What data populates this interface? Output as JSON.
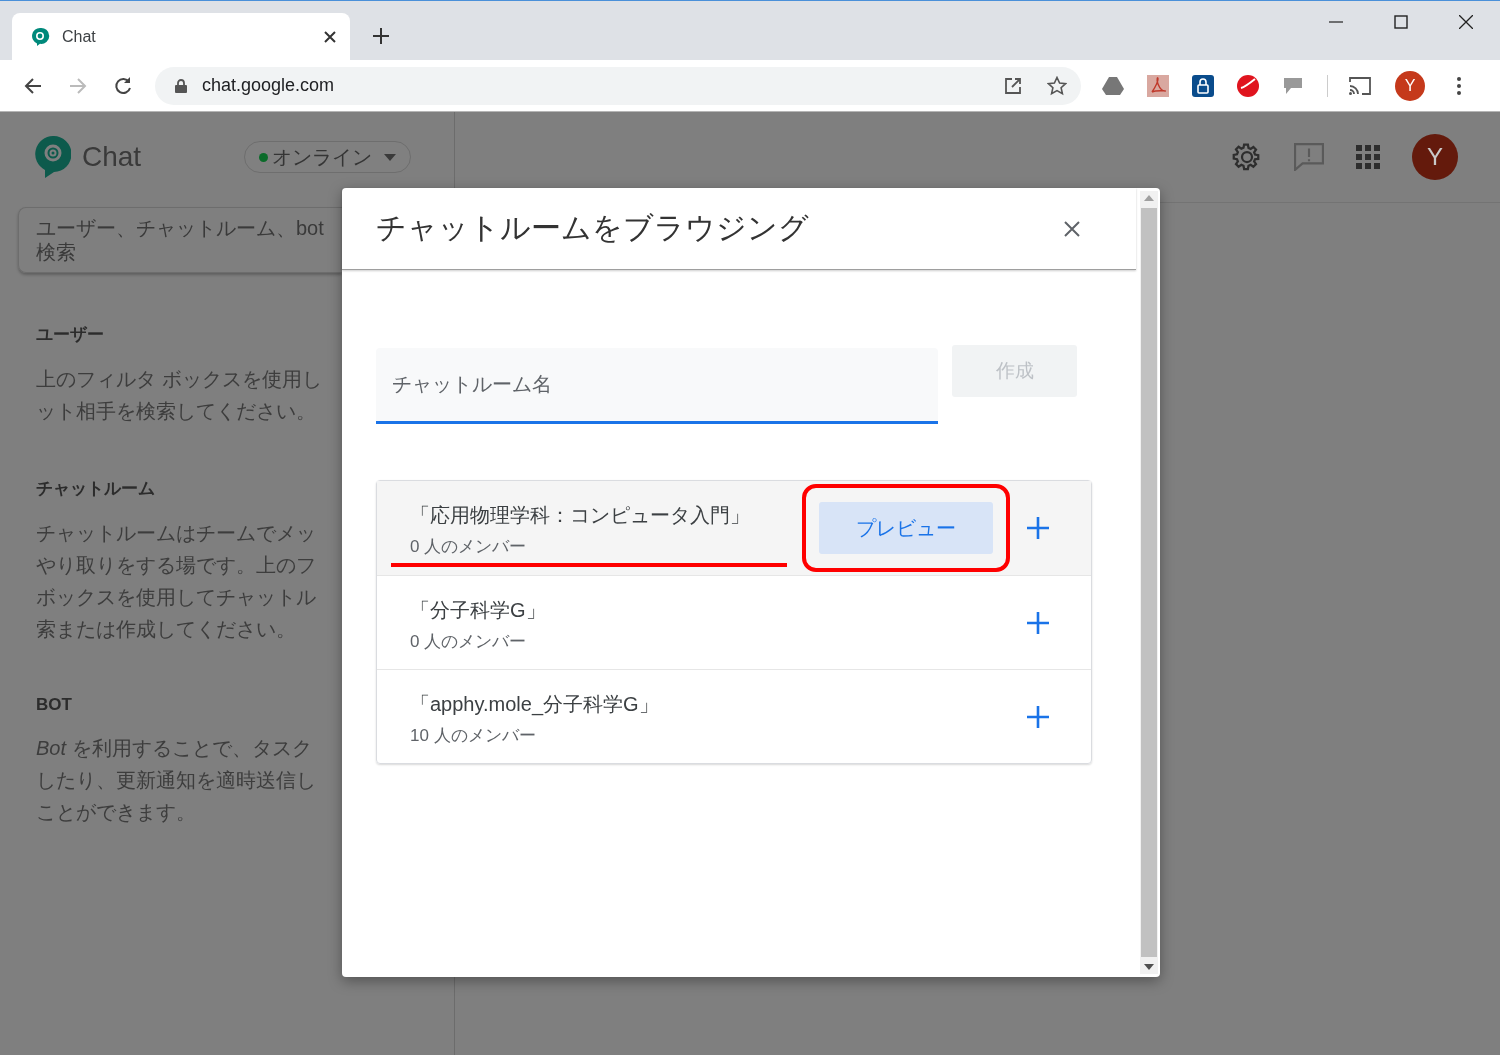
{
  "browser": {
    "tab": {
      "title": "Chat"
    },
    "address": "chat.google.com",
    "forward_disabled": true,
    "avatar": "Y"
  },
  "app": {
    "logo": "Chat",
    "status": {
      "label": "オンライン",
      "online": true
    },
    "avatar": "Y",
    "search": {
      "placeholder_lines": [
        "ユーザー、チャットルーム、bot",
        "検索"
      ]
    },
    "sections": [
      {
        "heading": "ユーザー",
        "lines": [
          "上のフィルタ ボックスを使用し",
          "ット相手を検索してください。"
        ]
      },
      {
        "heading": "チャットルーム",
        "lines": [
          "チャットルームはチームでメッ",
          "やり取りをする場です。上のフ",
          "ボックスを使用してチャットル",
          "索または作成してください。"
        ]
      },
      {
        "heading": "BOT",
        "lines": [
          "*Bot* を利用することで、タスク",
          "したり、更新通知を適時送信し",
          "ことができます。"
        ]
      }
    ]
  },
  "dialog": {
    "title": "チャットルームをブラウジング",
    "name_field": {
      "placeholder": "チャットルーム名",
      "focused": true
    },
    "create_button": {
      "label": "作成",
      "disabled": true
    },
    "rooms": [
      {
        "name": "「応用物理学科：コンピュータ入門」",
        "members": "0 人のメンバー",
        "hovered": true,
        "preview": "プレビュー",
        "marked": true
      },
      {
        "name": "「分子科学G」",
        "members": "0 人のメンバー",
        "hovered": false,
        "marked": false
      },
      {
        "name": "「apphy.mole_分子科学G」",
        "members": "10 人のメンバー",
        "hovered": false,
        "marked": false
      }
    ]
  }
}
